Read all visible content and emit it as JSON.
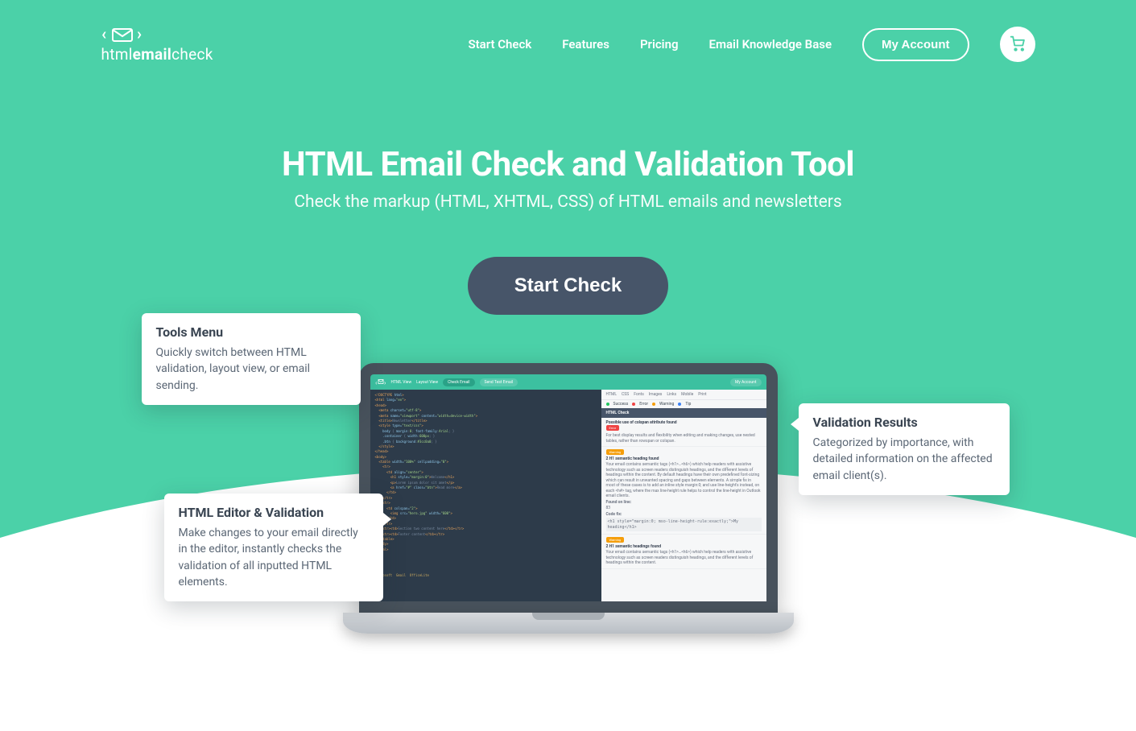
{
  "brand": {
    "text_html": "html",
    "text_email": "email",
    "text_check": "check"
  },
  "nav": {
    "items": [
      {
        "label": "Start Check"
      },
      {
        "label": "Features"
      },
      {
        "label": "Pricing"
      },
      {
        "label": "Email Knowledge Base"
      }
    ],
    "account_label": "My Account"
  },
  "hero": {
    "title": "HTML Email Check and Validation Tool",
    "subtitle": "Check the markup (HTML, XHTML, CSS) of HTML emails and newsletters",
    "cta": "Start Check"
  },
  "callouts": {
    "tools_menu": {
      "title": "Tools Menu",
      "body": "Quickly switch between HTML validation, layout view, or email sending."
    },
    "editor": {
      "title": "HTML Editor & Validation",
      "body": "Make changes to your email directly in the editor, instantly checks the validation of all inputted HTML elements."
    },
    "results": {
      "title": "Validation Results",
      "body": "Categorized by importance, with detailed information on the affected email client(s)."
    }
  },
  "app_preview": {
    "tabs": [
      "HTML View",
      "Layout View",
      "Check Email",
      "Send Test Email"
    ],
    "account": "My Account",
    "results_tabs": [
      "HTML",
      "CSS",
      "Fonts",
      "Images",
      "Links",
      "Mobile",
      "Print"
    ],
    "legend": [
      {
        "label": "Success",
        "color": "#22c55e"
      },
      {
        "label": "Error",
        "color": "#ef4444"
      },
      {
        "label": "Warning",
        "color": "#f59e0b"
      },
      {
        "label": "Tip",
        "color": "#3b82f6"
      }
    ],
    "results_header": "HTML Check",
    "results": [
      {
        "tag": "Error",
        "tag_color": "#ef4444",
        "title": "Possible use of colspan attribute found",
        "body": "For best display results and flexibility when editing and making changes, use nested tables, rather than rowspan or colspan."
      },
      {
        "tag": "Warning",
        "tag_color": "#f59e0b",
        "title": "2 H1 semantic heading found",
        "body": "Your email contains semantic tags (<h1>…<h6>) which help readers with assistive technology such as screen readers distinguish headings, and the different levels of headings within the content. By default headings have their own predefined font-sizing which can result in unwanted spacing and gaps between elements. A simple fix in most of these cases is to add an inline style margin:0; and use line-height's instead, on each <h#> tag, where the max line-height rule helps to control the line-height in Outlook email clients.",
        "found_label": "Found on line:",
        "found_value": "83",
        "code_label": "Code fix:",
        "code_value": "<h1 style=\"margin:0; mso-line-height-rule:exactly;\">My heading</h1>"
      },
      {
        "tag": "Warning",
        "tag_color": "#f59e0b",
        "title": "2 H1 semantic headings found",
        "body": "Your email contains semantic tags (<h1>…<h6>) which help readers with assistive technology such as screen readers distinguish headings, and the different levels of headings within the content."
      }
    ]
  },
  "colors": {
    "accent": "#4bd1a8",
    "dark": "#475569"
  }
}
